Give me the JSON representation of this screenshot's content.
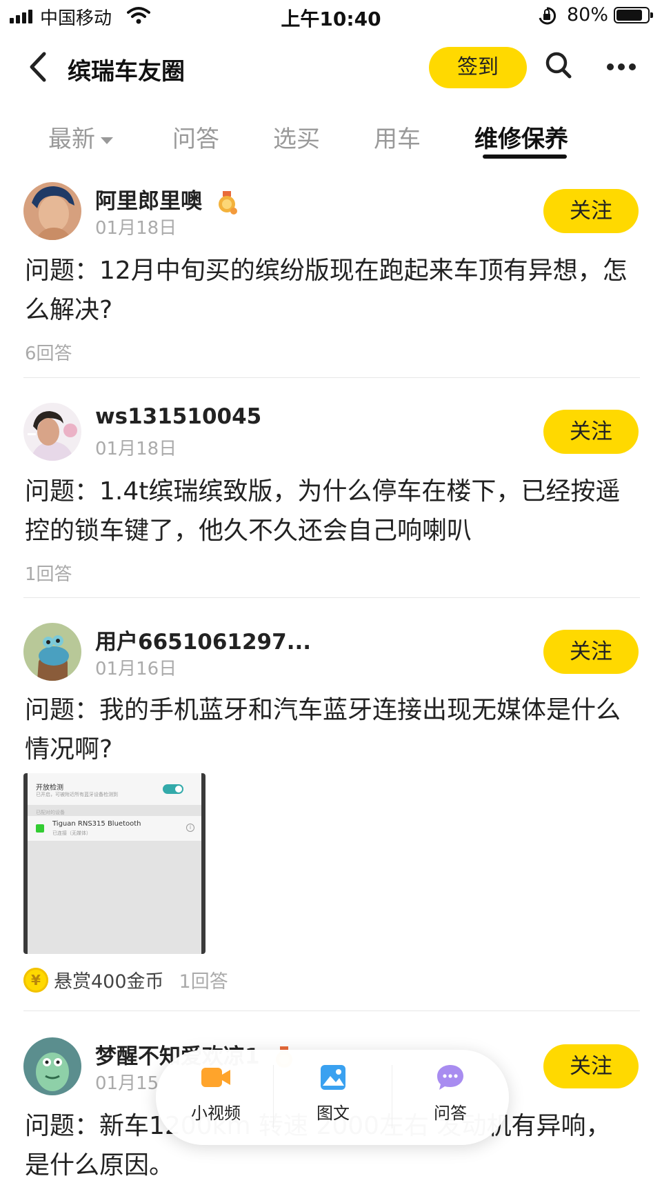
{
  "status_bar": {
    "carrier": "中国移动",
    "time": "上午10:40",
    "battery": "80%"
  },
  "header": {
    "title": "缤瑞车友圈",
    "signin_label": "签到"
  },
  "tabs": [
    {
      "label": "最新"
    },
    {
      "label": "问答"
    },
    {
      "label": "选买"
    },
    {
      "label": "用车"
    },
    {
      "label": "维修保养",
      "active": true
    }
  ],
  "follow_label": "关注",
  "posts": [
    {
      "username": "阿里郎里噢",
      "date": "01月18日",
      "question": "问题：12月中旬买的缤纷版现在跑起来车顶有异想，怎么解决?",
      "answers": "6回答"
    },
    {
      "username": "ws131510045",
      "date": "01月18日",
      "question": "问题：1.4t缤瑞缤致版，为什么停车在楼下，已经按遥控的锁车键了，他久不久还会自己响喇叭",
      "answers": "1回答"
    },
    {
      "username": "用户6651061297...",
      "date": "01月16日",
      "question": "问题：我的手机蓝牙和汽车蓝牙连接出现无媒体是什么情况啊?",
      "reward": "悬赏400金币",
      "answers": "1回答",
      "screenshot": {
        "title": "开放检测",
        "subtitle": "已开启，可被附近所有蓝牙设备检测到",
        "section": "已配对的设备",
        "device": "Tiguan RNS315 Bluetooth",
        "device_status": "已连接（无媒体）"
      }
    },
    {
      "username": "梦醒不知爱欢凉1",
      "date": "01月15",
      "question": "问题：新车1200km 转速 2000左右 发动机有异响，是什么原因。"
    }
  ],
  "floating_bar": [
    {
      "label": "小视频",
      "icon": "video-icon",
      "color": "#ffa42b"
    },
    {
      "label": "图文",
      "icon": "image-icon",
      "color": "#3aa1f0"
    },
    {
      "label": "问答",
      "icon": "chat-icon",
      "color": "#a88cf0"
    }
  ],
  "colors": {
    "accent": "#ffd900"
  }
}
